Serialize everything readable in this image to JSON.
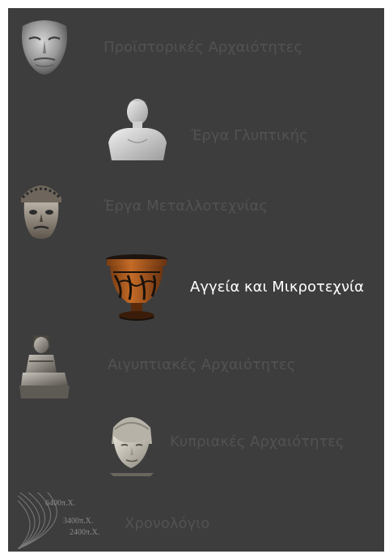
{
  "menu": {
    "items": [
      {
        "label": "Προϊστορικές Αρχαιότητες",
        "icon": "gold-mask-icon"
      },
      {
        "label": "Έργα Γλυπτικής",
        "icon": "marble-bust-icon"
      },
      {
        "label": "Έργα Μεταλλοτεχνίας",
        "icon": "bronze-helmet-icon"
      },
      {
        "label": "Αγγεία και Μικροτεχνία",
        "icon": "krater-vase-icon"
      },
      {
        "label": "Αιγυπτιακές Αρχαιότητες",
        "icon": "seated-statue-icon"
      },
      {
        "label": "Κυπριακές Αρχαιότητες",
        "icon": "stone-head-icon"
      },
      {
        "label": "Χρονολόγιο",
        "icon": "timeline-icon"
      }
    ],
    "active_index": 3
  },
  "timeline": {
    "marks": [
      "6400π.Χ.",
      "3400π.Χ.",
      "2400π.Χ."
    ]
  },
  "colors": {
    "background": "#3d3d3d",
    "label_inactive": "#525252",
    "label_active": "#ffffff"
  }
}
